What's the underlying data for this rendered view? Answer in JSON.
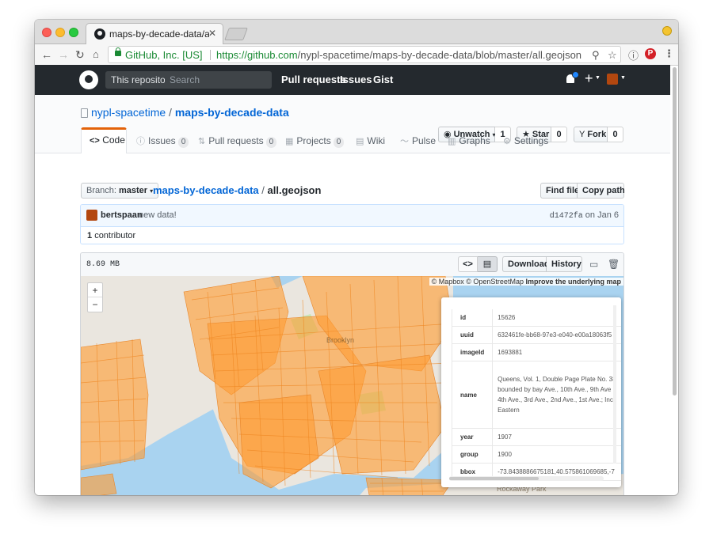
{
  "browser": {
    "tab_title": "maps-by-decade-data/all.geoj",
    "tab_close": "✕",
    "secure_label": "GitHub, Inc. [US]",
    "url_scheme_host": "https://github.com",
    "url_path": "/nypl-spacetime/maps-by-decade-data/blob/master/all.geojson"
  },
  "github": {
    "scope_label": "This repository",
    "search_placeholder": "Search",
    "nav": [
      "Pull requests",
      "Issues",
      "Gist"
    ]
  },
  "repo": {
    "owner": "nypl-spacetime",
    "separator": "/",
    "name": "maps-by-decade-data",
    "watch": {
      "label": "Unwatch",
      "count": "1"
    },
    "star": {
      "label": "Star",
      "count": "0"
    },
    "fork": {
      "label": "Fork",
      "count": "0"
    },
    "tabs": {
      "code": "Code",
      "issues": {
        "label": "Issues",
        "count": "0"
      },
      "pulls": {
        "label": "Pull requests",
        "count": "0"
      },
      "projects": {
        "label": "Projects",
        "count": "0"
      },
      "wiki": "Wiki",
      "pulse": "Pulse",
      "graphs": "Graphs",
      "settings": "Settings"
    }
  },
  "file_nav": {
    "branch_label": "Branch:",
    "branch": "master",
    "path_repo": "maps-by-decade-data",
    "path_sep": "/",
    "path_file": "all.geojson",
    "find_file": "Find file",
    "copy_path": "Copy path"
  },
  "commit": {
    "author": "bertspaan",
    "message": "new data!",
    "sha": "d1472fa",
    "date_text": "on Jan 6",
    "contributor_count": "1",
    "contributor_label": "contributor"
  },
  "file": {
    "size": "8.69 MB",
    "download": "Download",
    "history": "History"
  },
  "map": {
    "attribution_mapbox": "© Mapbox",
    "attribution_osm": "© OpenStreetMap",
    "attribution_improve": "Improve the underlying map",
    "zoom_in": "+",
    "zoom_out": "−",
    "labels": {
      "brooklyn": "Brooklyn",
      "rockaway": "Rockaway Park"
    },
    "popup": [
      {
        "key": "id",
        "value": "15626"
      },
      {
        "key": "uuid",
        "value": "632461fe-bb68-97e3-e040-e00a18063f5"
      },
      {
        "key": "imageId",
        "value": "1693881"
      },
      {
        "key": "name",
        "value": "Queens, Vol. 1, Double Page Plate No. 38\nbounded by bay Ave., 10th Ave., 9th Ave\n4th Ave., 3rd Ave., 2nd Ave., 1st Ave.; Inc\nEastern"
      },
      {
        "key": "year",
        "value": "1907"
      },
      {
        "key": "group",
        "value": "1900"
      },
      {
        "key": "bbox",
        "value": "-73.8438886675181,40.575861069685,-7"
      }
    ]
  },
  "colors": {
    "accent_tab": "#e36209",
    "map_overlay": "#ff9d33",
    "map_water": "#a9d3f0",
    "map_land": "#eae6df",
    "link": "#0366d6"
  }
}
